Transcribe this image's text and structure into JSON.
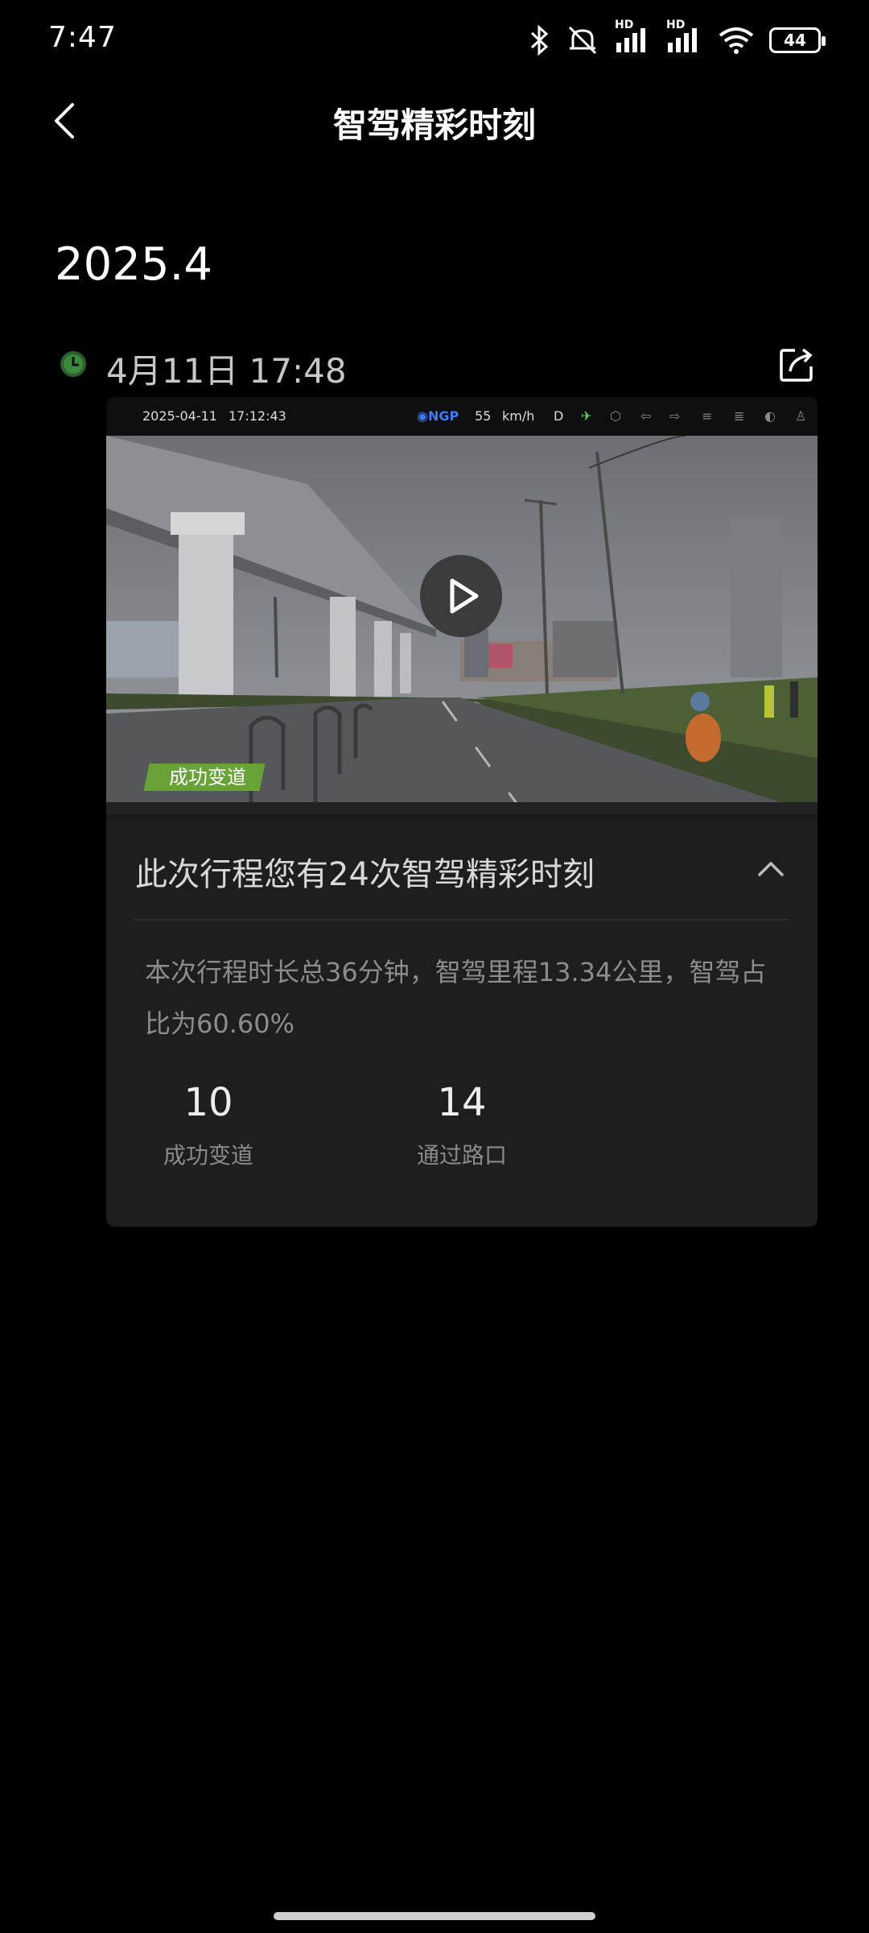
{
  "status_bar": {
    "time": "7:47",
    "hd1": "HD",
    "hd2": "HD",
    "battery": "44"
  },
  "header": {
    "title": "智驾精彩时刻"
  },
  "month_label": "2025.4",
  "entry": {
    "datetime": "4月11日 17:48",
    "video": {
      "hud": {
        "date": "2025-04-11",
        "time": "17:12:43",
        "mode": "NGP",
        "speed": "55",
        "speed_unit": "km/h",
        "gear": "D"
      },
      "tag_label": "成功变道"
    },
    "summary": "此次行程您有24次智驾精彩时刻",
    "description": "本次行程时长总36分钟，智驾里程13.34公里，智驾占比为60.60%",
    "stats": [
      {
        "value": "10",
        "label": "成功变道"
      },
      {
        "value": "14",
        "label": "通过路口"
      }
    ]
  },
  "colors": {
    "background": "#000000",
    "card": "#1e1e1e",
    "tag_green": "#6aa23a",
    "clock_green": "#3c8a3c"
  }
}
